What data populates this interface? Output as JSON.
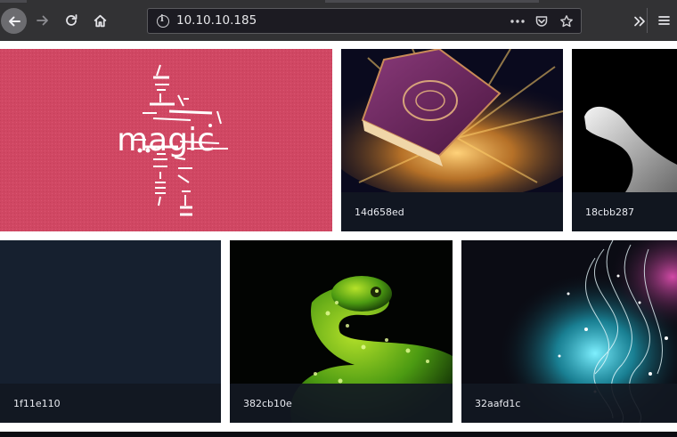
{
  "browser": {
    "url": "10.10.10.185"
  },
  "gallery": {
    "tiles": [
      {
        "caption": "",
        "image": "magic-word-pink"
      },
      {
        "caption": "14d658ed",
        "image": "glowing-book"
      },
      {
        "caption": "18cbb287",
        "image": "white-hand"
      },
      {
        "caption": "1f11e110",
        "image": "dark-navy"
      },
      {
        "caption": "382cb10e",
        "image": "green-snake"
      },
      {
        "caption": "32aafd1c",
        "image": "cyan-magic-swirls"
      }
    ],
    "magic_word": "magic"
  },
  "colors": {
    "toolbar": "#323234",
    "urlbar": "#1c1b22",
    "caption_bar": "#121822",
    "pink_tile": "#d04763"
  }
}
